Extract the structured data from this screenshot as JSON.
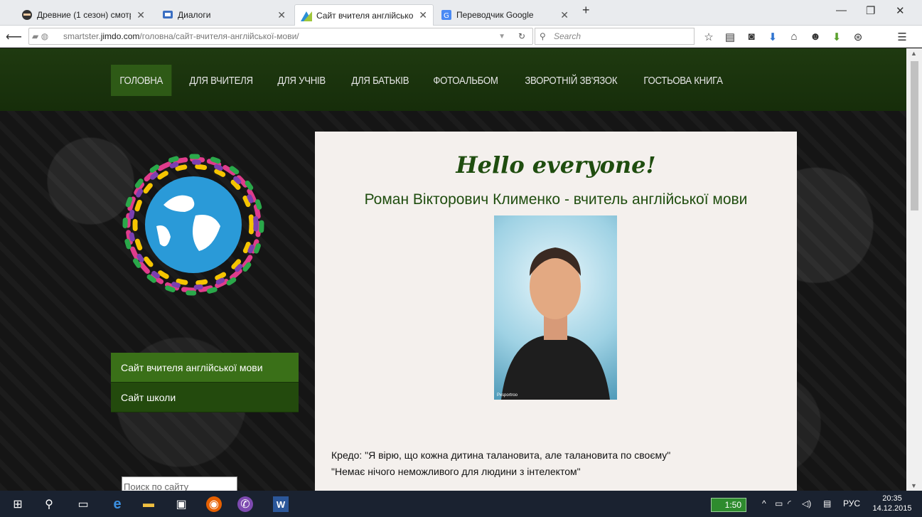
{
  "tabs": [
    {
      "title": "Древние (1 сезон) смотр...",
      "icon": "ninja-icon",
      "active": false
    },
    {
      "title": "Диалоги",
      "icon": "chat-icon",
      "active": false
    },
    {
      "title": "Сайт вчителя англійської...",
      "icon": "jimdo-icon",
      "active": true
    },
    {
      "title": "Переводчик Google",
      "icon": "translate-icon",
      "active": false
    }
  ],
  "url": {
    "prefix": "smartster.",
    "domain": "jimdo.com",
    "path": "/головна/сайт-вчителя-англійської-мови/"
  },
  "search_placeholder": "Search",
  "site": {
    "menu": [
      "ГОЛОВНА",
      "ДЛЯ ВЧИТЕЛЯ",
      "ДЛЯ УЧНІВ",
      "ДЛЯ БАТЬКІВ",
      "ФОТОАЛЬБОМ",
      "ЗВОРОТНІЙ ЗВ'ЯЗОК",
      "ГОСТЬОВА КНИГА"
    ],
    "side": [
      "Сайт вчителя англійської мови",
      "Сайт школи"
    ],
    "search_placeholder": "Поиск по сайту",
    "hello": "Hello everyone!",
    "name": "Роман Вікторович Клименко - вчитель англійської мови",
    "photo_caption": "Рхsportroo",
    "credo1": "Кредо: \"Я вірю, що кожна дитина талановита, але талановита по своєму\"",
    "credo2": "\"Немає нічого неможливого для людини з інтелектом\""
  },
  "taskbar": {
    "battery": "1:50",
    "lang": "РУС",
    "time": "20:35",
    "date": "14.12.2015"
  },
  "colors": {
    "nav_green": "#1f3a10",
    "active_green": "#2e5a16",
    "heading_green": "#1f4d0f"
  }
}
